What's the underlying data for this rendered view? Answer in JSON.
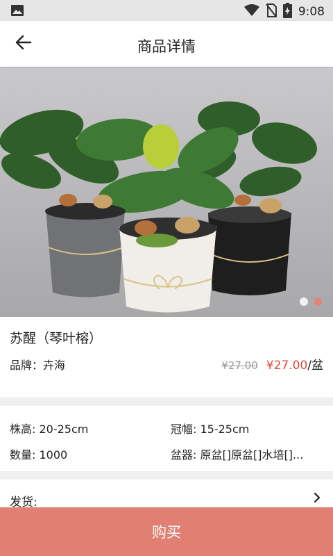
{
  "status_bar": {
    "time": "9:08"
  },
  "header": {
    "title": "商品详情"
  },
  "gallery": {
    "slide_count": 2,
    "active_slide": 2
  },
  "product": {
    "name": "苏醒（琴叶榕）",
    "brand": "品牌：卉海",
    "original_price": "¥27.00",
    "price": "¥27.00",
    "unit": "/盆"
  },
  "specs": {
    "height": "株高: 20-25cm",
    "crown": "冠幅: 15-25cm",
    "quantity": "数量: 1000",
    "pot": "盆器: 原盆[]原盆[]水培[]..."
  },
  "shipping": {
    "label": "发货:"
  },
  "footer": {
    "buy_label": "购买"
  },
  "colors": {
    "accent": "#e07f72",
    "price_red": "#e0483a",
    "status_bar": "#e6e6e6"
  }
}
